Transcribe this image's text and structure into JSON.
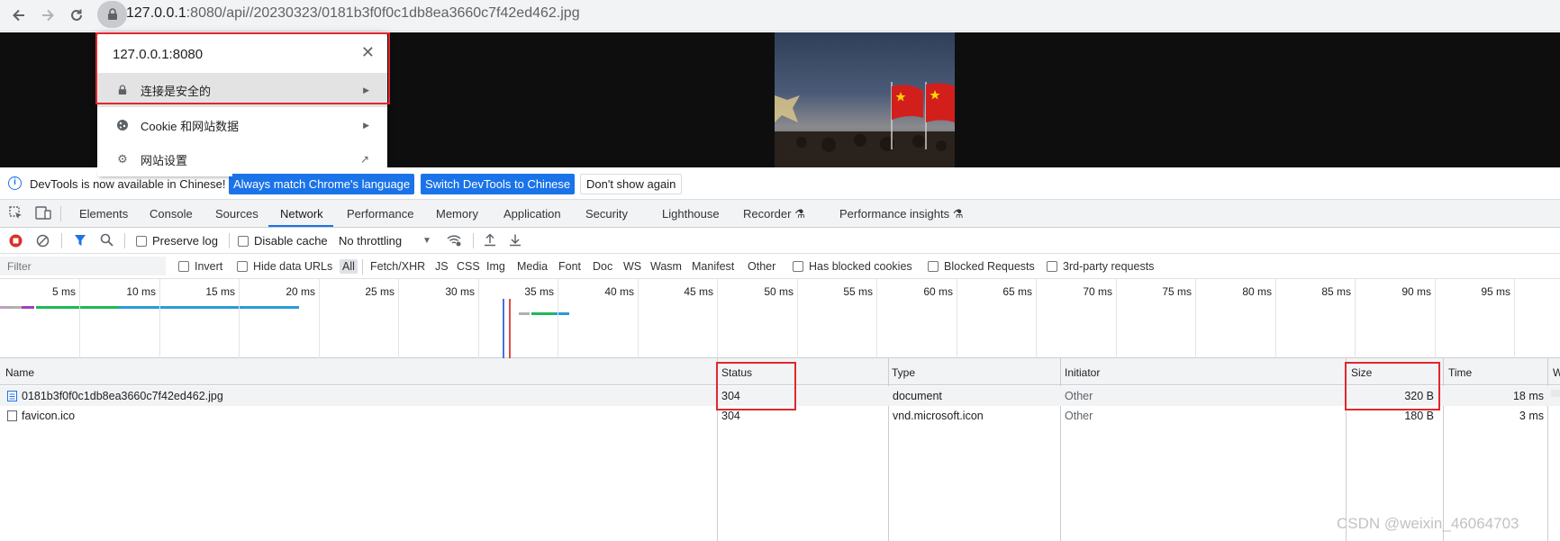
{
  "browser": {
    "url_host": "127.0.0.1",
    "url_rest": ":8080/api//20230323/0181b3f0f0c1db8ea3660c7f42ed462.jpg"
  },
  "site_popup": {
    "host": "127.0.0.1:8080",
    "items": [
      {
        "label": "连接是安全的",
        "icon": "lock-icon"
      },
      {
        "label": "Cookie 和网站数据",
        "icon": "cookie-icon"
      },
      {
        "label": "网站设置",
        "icon": "gear-icon"
      }
    ]
  },
  "infobar": {
    "message": "DevTools is now available in Chinese!",
    "btn_match": "Always match Chrome's language",
    "btn_switch": "Switch DevTools to Chinese",
    "btn_dismiss": "Don't show again"
  },
  "tabs": [
    "Elements",
    "Console",
    "Sources",
    "Network",
    "Performance",
    "Memory",
    "Application",
    "Security",
    "Lighthouse",
    "Recorder",
    "Performance insights"
  ],
  "active_tab": "Network",
  "toolbar": {
    "preserve_log": "Preserve log",
    "disable_cache": "Disable cache",
    "throttling": "No throttling"
  },
  "filterbar": {
    "placeholder": "Filter",
    "invert": "Invert",
    "hide_data_urls": "Hide data URLs",
    "types": [
      "All",
      "Fetch/XHR",
      "JS",
      "CSS",
      "Img",
      "Media",
      "Font",
      "Doc",
      "WS",
      "Wasm",
      "Manifest",
      "Other"
    ],
    "has_blocked_cookies": "Has blocked cookies",
    "blocked_requests": "Blocked Requests",
    "third_party": "3rd-party requests"
  },
  "timeline": {
    "ticks": [
      "5 ms",
      "10 ms",
      "15 ms",
      "20 ms",
      "25 ms",
      "30 ms",
      "35 ms",
      "40 ms",
      "45 ms",
      "50 ms",
      "55 ms",
      "60 ms",
      "65 ms",
      "70 ms",
      "75 ms",
      "80 ms",
      "85 ms",
      "90 ms",
      "95 ms",
      "1"
    ]
  },
  "table": {
    "columns": [
      "Name",
      "Status",
      "Type",
      "Initiator",
      "Size",
      "Time",
      "W"
    ],
    "rows": [
      {
        "name": "0181b3f0f0c1db8ea3660c7f42ed462.jpg",
        "status": "304",
        "type": "document",
        "initiator": "Other",
        "size": "320 B",
        "time": "18 ms"
      },
      {
        "name": "favicon.ico",
        "status": "304",
        "type": "vnd.microsoft.icon",
        "initiator": "Other",
        "size": "180 B",
        "time": "3 ms"
      }
    ]
  },
  "watermark": "CSDN @weixin_46064703",
  "colors": {
    "accent": "#1a73e8",
    "highlight_box": "#e0282e"
  }
}
